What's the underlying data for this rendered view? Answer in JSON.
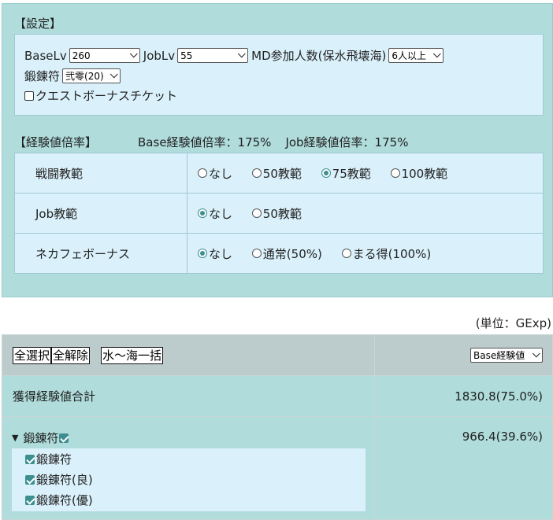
{
  "settings": {
    "title": "【設定】",
    "base_lv_label": "BaseLv",
    "base_lv_value": "260",
    "job_lv_label": "JobLv",
    "job_lv_value": "55",
    "md_label": "MD参加人数(保水飛壊海)",
    "md_value": "6人以上",
    "forge_label": "鍛錬符",
    "forge_value": "弐零(20)",
    "quest_bonus_label": "クエストボーナスチケット",
    "quest_bonus_checked": false
  },
  "exp_rate": {
    "title": "【経験値倍率】",
    "base_rate": "Base経験値倍率：175%",
    "job_rate": "Job経験値倍率：175%",
    "rows": [
      {
        "label": "戦闘教範",
        "options": [
          "なし",
          "50教範",
          "75教範",
          "100教範"
        ],
        "selected": 2
      },
      {
        "label": "Job教範",
        "options": [
          "なし",
          "50教範"
        ],
        "selected": 0
      },
      {
        "label": "ネカフェボーナス",
        "options": [
          "なし",
          "通常(50%)",
          "まる得(100%)"
        ],
        "selected": 0
      }
    ]
  },
  "results": {
    "unit": "(単位：GExp)",
    "select_all": "全選択",
    "deselect_all": "全解除",
    "batch": "水〜海一括",
    "view_select": "Base経験値",
    "total_label": "獲得経験値合計",
    "total_value": "1830.8(75.0%)",
    "group": {
      "title": "鍛錬符",
      "value": "966.4(39.6%)",
      "items": [
        "鍛錬符",
        "鍛錬符(良)",
        "鍛錬符(優)"
      ]
    }
  },
  "colors": {
    "panel_bg": "#b0dcdc",
    "box_bg": "#daf1fb",
    "header_bg": "#bccccc",
    "accent": "#3d8f8f"
  }
}
